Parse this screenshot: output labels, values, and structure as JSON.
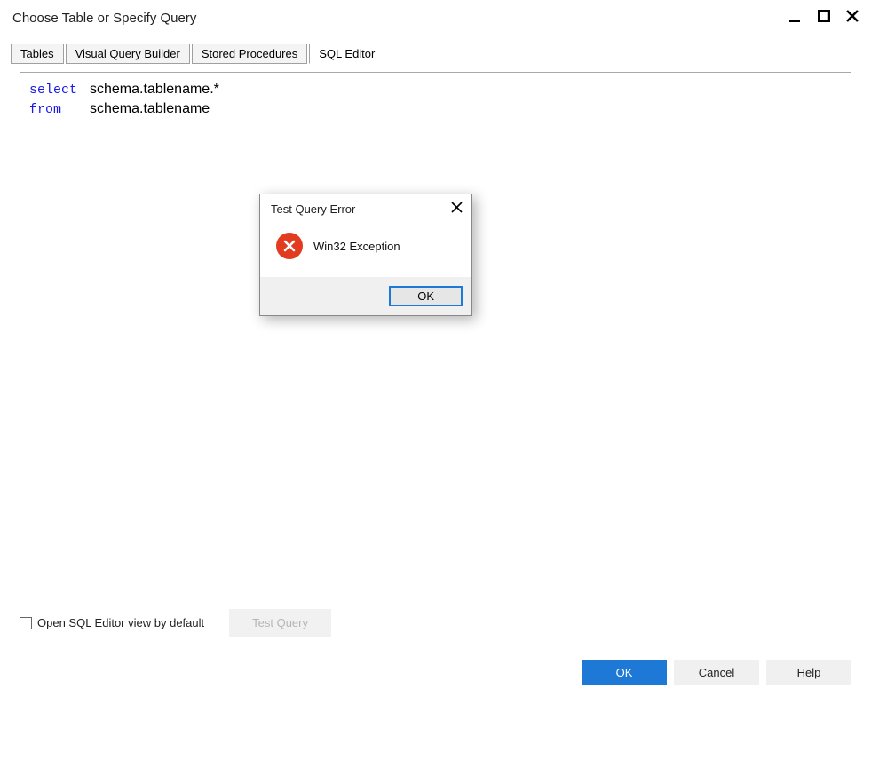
{
  "window": {
    "title": "Choose Table or Specify Query"
  },
  "tabs": {
    "items": [
      {
        "label": "Tables"
      },
      {
        "label": "Visual Query Builder"
      },
      {
        "label": "Stored Procedures"
      },
      {
        "label": "SQL Editor"
      }
    ],
    "activeIndex": 3
  },
  "editor": {
    "lines": [
      {
        "keyword": "select",
        "text": "schema.tablename.*"
      },
      {
        "keyword": "from",
        "text": "schema.tablename"
      }
    ]
  },
  "options": {
    "openByDefaultLabel": "Open SQL Editor view by default",
    "testQueryLabel": "Test Query"
  },
  "footer": {
    "ok": "OK",
    "cancel": "Cancel",
    "help": "Help"
  },
  "modal": {
    "title": "Test Query Error",
    "message": "Win32 Exception",
    "ok": "OK"
  }
}
